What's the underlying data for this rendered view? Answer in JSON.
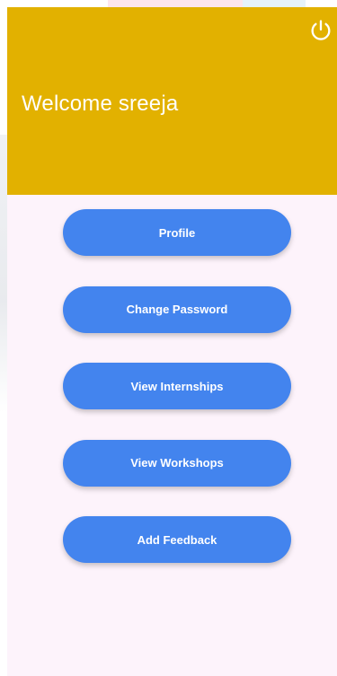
{
  "header": {
    "welcome_text": "Welcome sreeja",
    "logout_icon": "power-icon",
    "background_color": "#e2b100"
  },
  "menu": {
    "button_color": "#4384ee",
    "items": [
      {
        "label": "Profile"
      },
      {
        "label": "Change Password"
      },
      {
        "label": "View Internships"
      },
      {
        "label": "View Workshops"
      },
      {
        "label": "Add Feedback"
      }
    ]
  },
  "colors": {
    "page_background": "#fdf3fb",
    "text_on_accent": "#ffffff"
  }
}
